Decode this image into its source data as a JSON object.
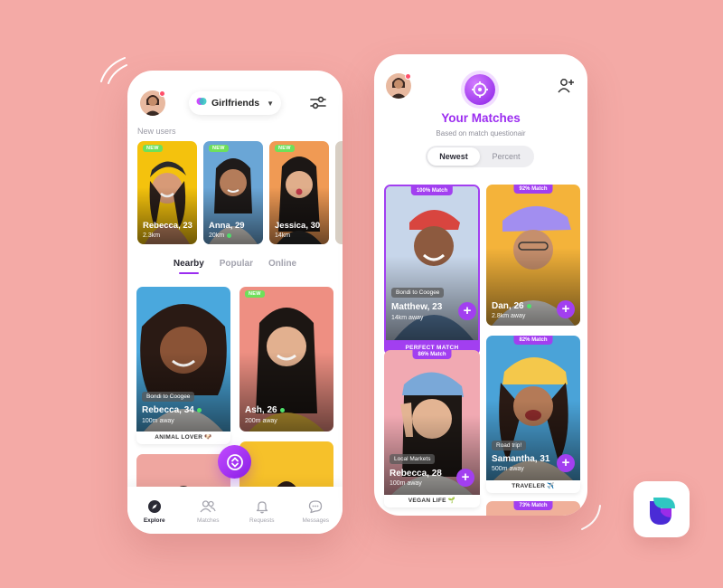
{
  "colors": {
    "background": "#f4aaa6",
    "accent": "#9b2cf0",
    "online": "#4ee06a",
    "new_badge": "#6ee05a"
  },
  "explore_screen": {
    "group_selector": {
      "label": "Girlfriends",
      "icon": "chevron-down-icon"
    },
    "filter_icon": "sliders-icon",
    "new_users_label": "New users",
    "new_users": [
      {
        "badge": "NEW",
        "name": "Rebecca, 23",
        "distance": "2.3km",
        "online": false
      },
      {
        "badge": "NEW",
        "name": "Anna, 29",
        "distance": "20km",
        "online": true
      },
      {
        "badge": "NEW",
        "name": "Jessica, 30",
        "distance": "14km",
        "online": false
      }
    ],
    "tabs": [
      {
        "label": "Nearby",
        "active": true
      },
      {
        "label": "Popular",
        "active": false
      },
      {
        "label": "Online",
        "active": false
      }
    ],
    "nearby_cards": [
      {
        "tag": "Bondi to Coogee",
        "name": "Rebecca, 34",
        "distance": "100m away",
        "online": true,
        "caption": "ANIMAL LOVER 🐶"
      },
      {
        "badge": "NEW",
        "name": "Ash, 26",
        "distance": "200m away",
        "online": true
      }
    ],
    "bottom_nav": [
      {
        "label": "Explore",
        "icon": "compass-icon",
        "active": true
      },
      {
        "label": "Matches",
        "icon": "people-icon",
        "active": false
      },
      {
        "label": "Requests",
        "icon": "bell-icon",
        "active": false
      },
      {
        "label": "Messages",
        "icon": "chat-icon",
        "active": false
      }
    ]
  },
  "matches_screen": {
    "title": "Your Matches",
    "subtitle": "Based on match questionair",
    "add_friend_icon": "add-people-icon",
    "segments": [
      {
        "label": "Newest",
        "active": true
      },
      {
        "label": "Percent",
        "active": false
      }
    ],
    "matches": [
      {
        "percent": "100% Match",
        "tag": "Bondi to Coogee",
        "name": "Matthew, 23",
        "distance": "14km away",
        "online": false,
        "footer": "PERFECT MATCH",
        "highlighted": true
      },
      {
        "percent": "92% Match",
        "name": "Dan, 26",
        "distance": "2.8km away",
        "online": true
      },
      {
        "percent": "86% Match",
        "tag": "Local Markets",
        "name": "Rebecca, 28",
        "distance": "100m away",
        "online": false,
        "footer": "VEGAN LIFE 🌱"
      },
      {
        "percent": "82% Match",
        "tag": "Road trip!",
        "name": "Samantha, 31",
        "distance": "500m away",
        "online": false,
        "footer": "TRAVELER ✈️"
      },
      {
        "percent": "73% Match"
      }
    ]
  }
}
